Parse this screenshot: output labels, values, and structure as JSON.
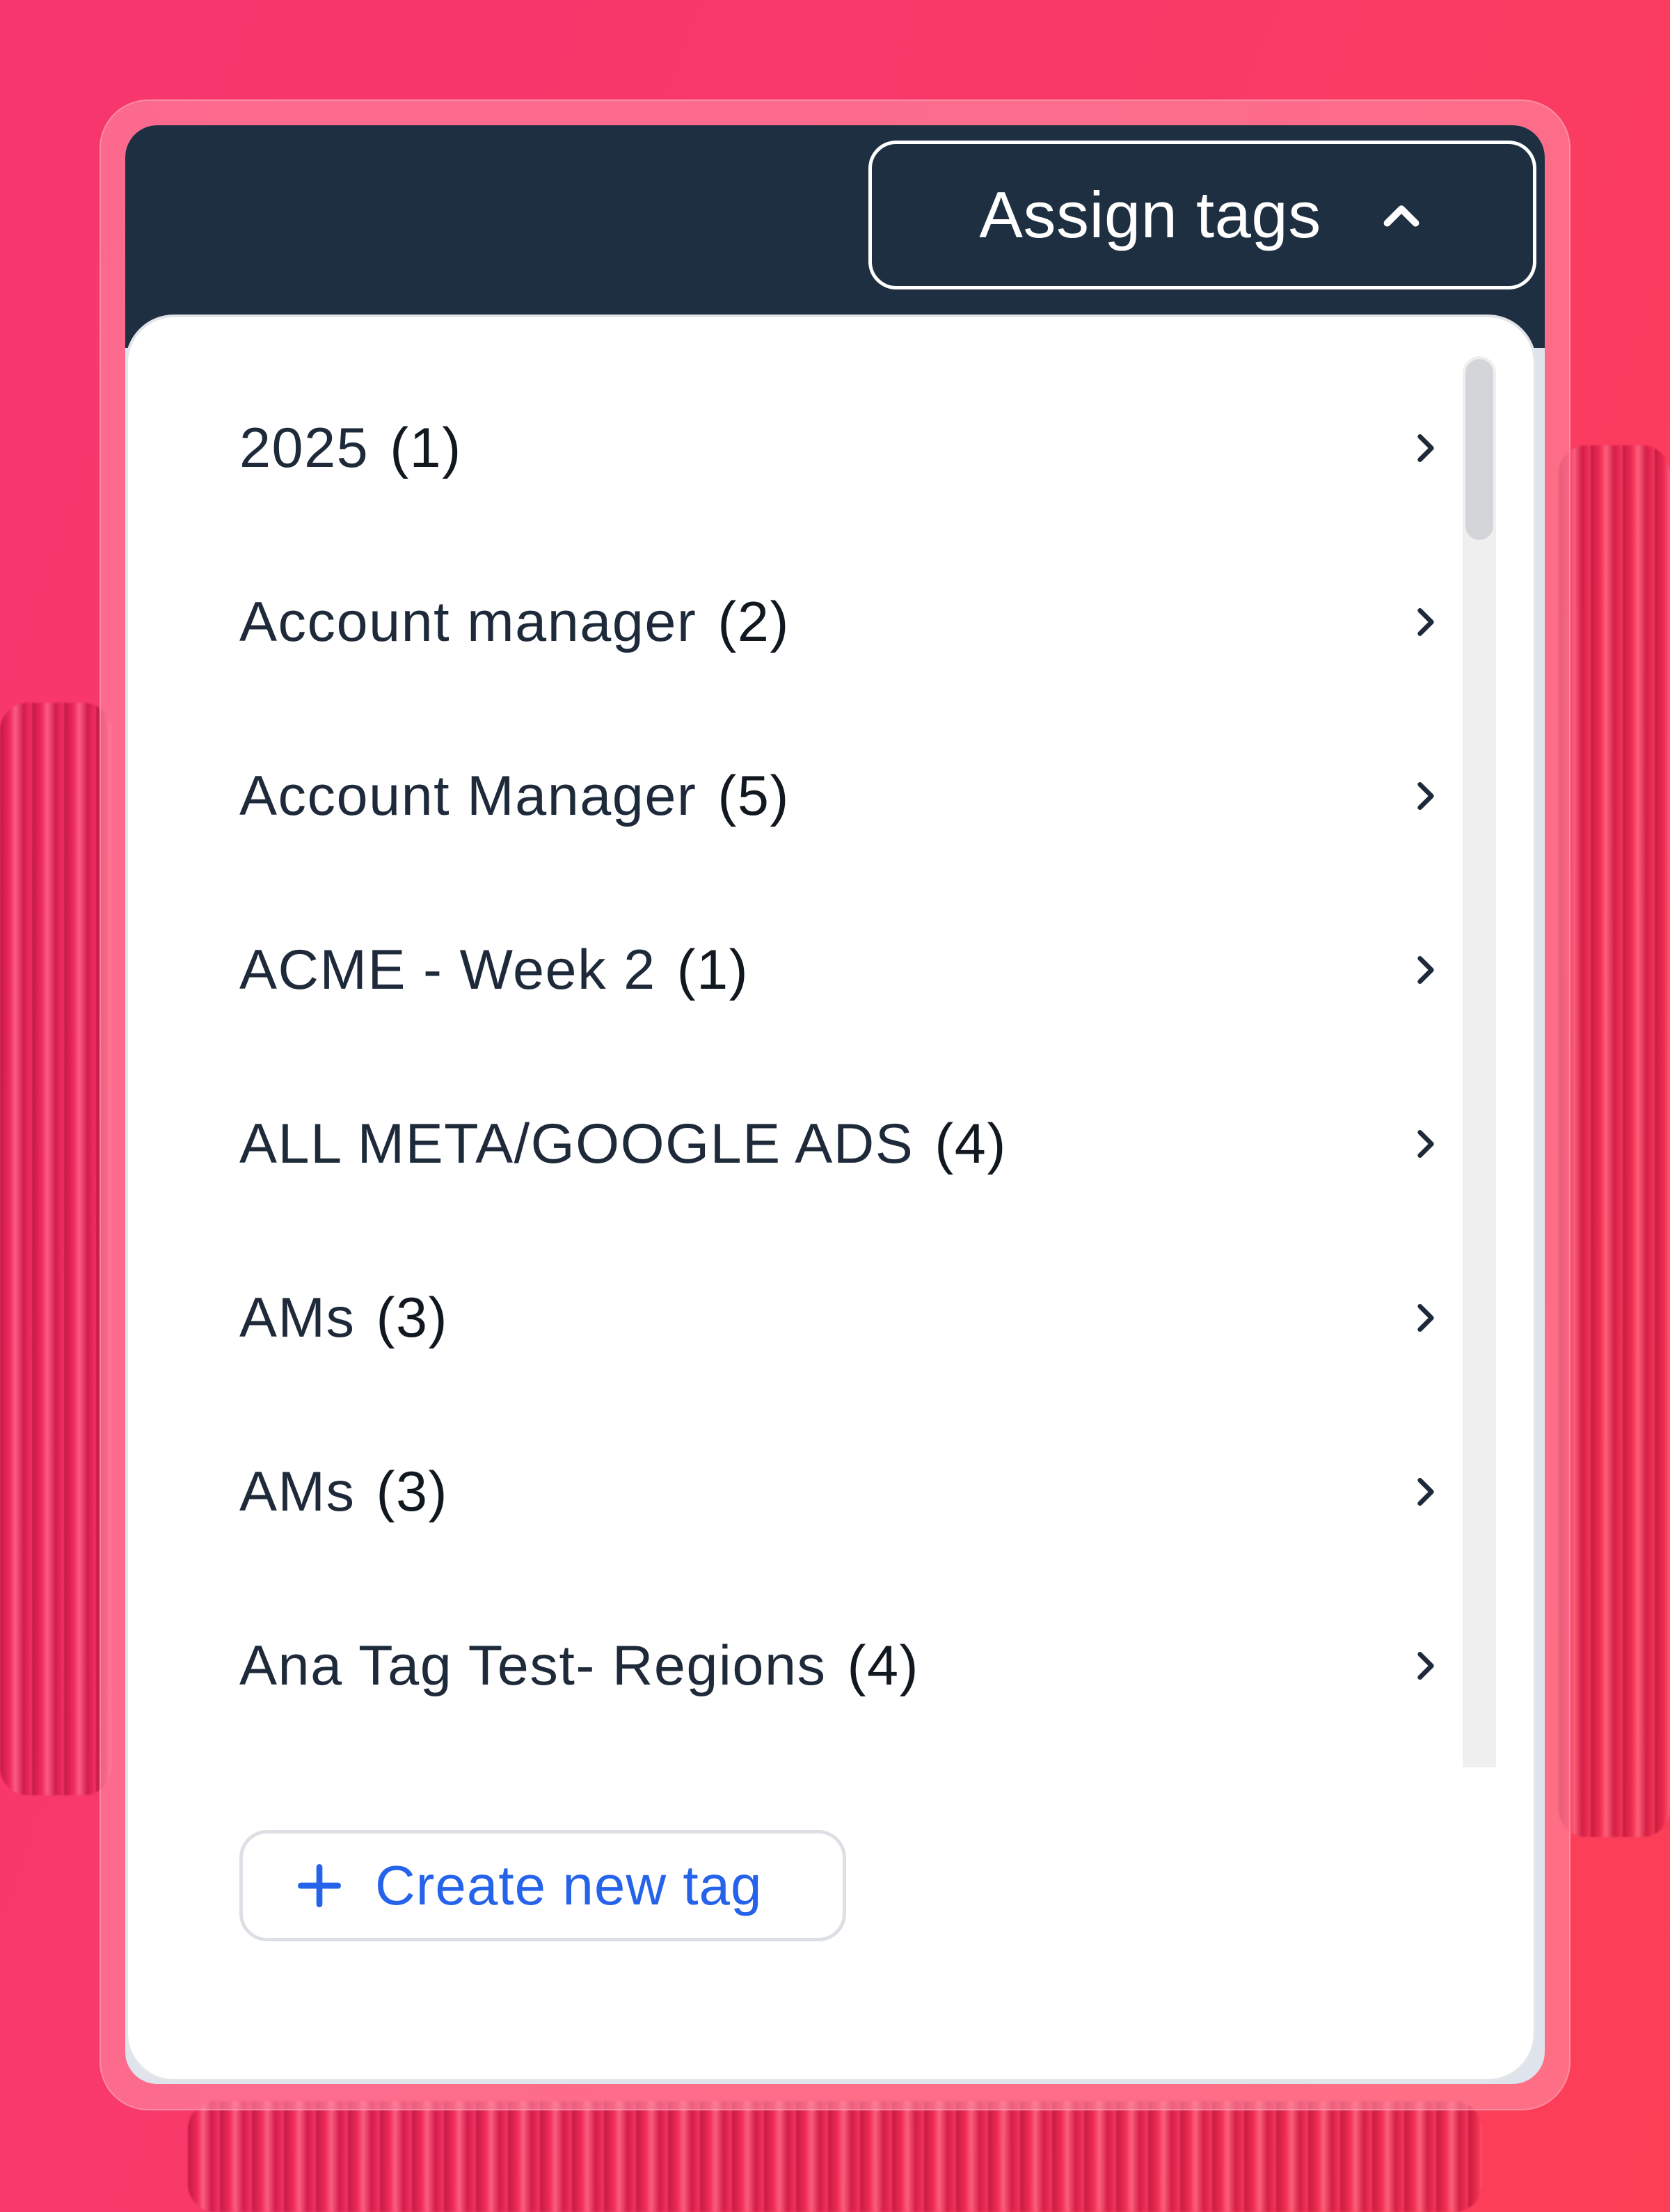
{
  "header": {
    "assign_button_label": "Assign tags",
    "assign_button_icon": "chevron-up-icon"
  },
  "tag_list": {
    "items": [
      {
        "label": "2025",
        "count": "(1)",
        "icon": "chevron-right-icon"
      },
      {
        "label": "Account manager",
        "count": "(2)",
        "icon": "chevron-right-icon"
      },
      {
        "label": "Account Manager",
        "count": "(5)",
        "icon": "chevron-right-icon"
      },
      {
        "label": "ACME - Week 2",
        "count": "(1)",
        "icon": "chevron-right-icon"
      },
      {
        "label": "ALL META/GOOGLE ADS",
        "count": "(4)",
        "icon": "chevron-right-icon"
      },
      {
        "label": "AMs",
        "count": "(3)",
        "icon": "chevron-right-icon"
      },
      {
        "label": "AMs",
        "count": "(3)",
        "icon": "chevron-right-icon"
      },
      {
        "label": "Ana Tag Test- Regions",
        "count": "(4)",
        "icon": "chevron-right-icon"
      }
    ]
  },
  "footer": {
    "create_button_label": "Create new tag",
    "create_button_icon": "plus-icon"
  },
  "colors": {
    "header_bg": "#1f2f42",
    "link_blue": "#2563eb",
    "text_dark": "#1e2a3a",
    "background_pink": "#f93a68"
  }
}
